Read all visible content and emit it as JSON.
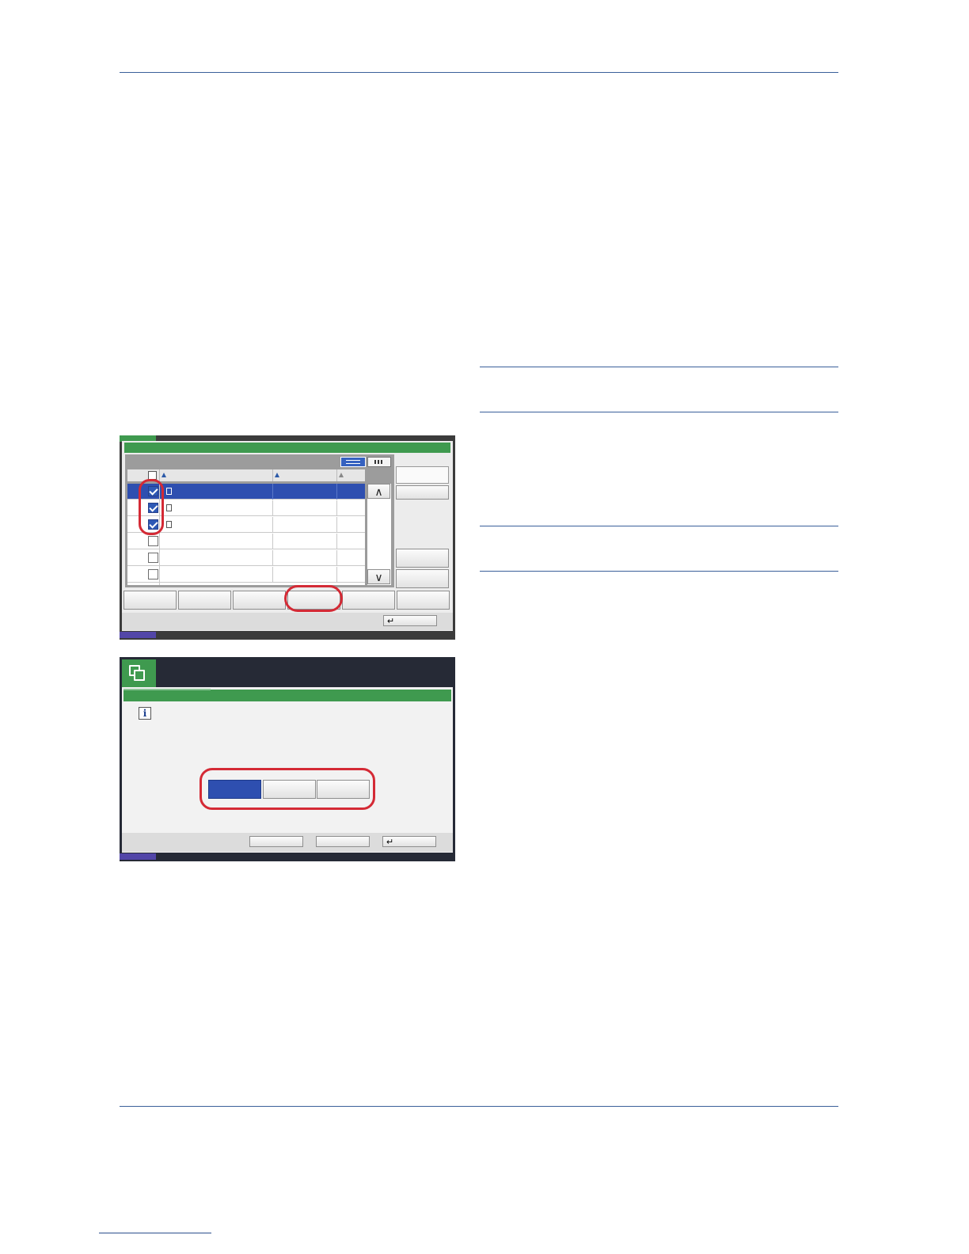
{
  "page": {
    "rule_color": "#3a5f9a"
  },
  "screen1": {
    "accent_green": "#3f9a4f",
    "selected_row_color": "#2e4fb0",
    "highlight_ring_color": "#d42a35",
    "rows": [
      {
        "checked": true,
        "selected": true,
        "has_icon": true
      },
      {
        "checked": true,
        "selected": false,
        "has_icon": true
      },
      {
        "checked": true,
        "selected": false,
        "has_icon": true
      },
      {
        "checked": false,
        "selected": false,
        "has_icon": false
      },
      {
        "checked": false,
        "selected": false,
        "has_icon": false
      },
      {
        "checked": false,
        "selected": false,
        "has_icon": false
      }
    ],
    "icons": [
      "list-view-icon",
      "thumbnail-view-icon",
      "scroll-up-icon",
      "scroll-down-icon",
      "return-arrow-icon"
    ],
    "return_glyph": "↵",
    "up_glyph": "∧",
    "down_glyph": "∨"
  },
  "screen2": {
    "accent_green": "#3f9a4f",
    "selected_button_color": "#2e4fb0",
    "icons": [
      "document-box-icon",
      "info-icon",
      "return-arrow-icon"
    ],
    "info_glyph": "i",
    "return_glyph": "↵"
  }
}
